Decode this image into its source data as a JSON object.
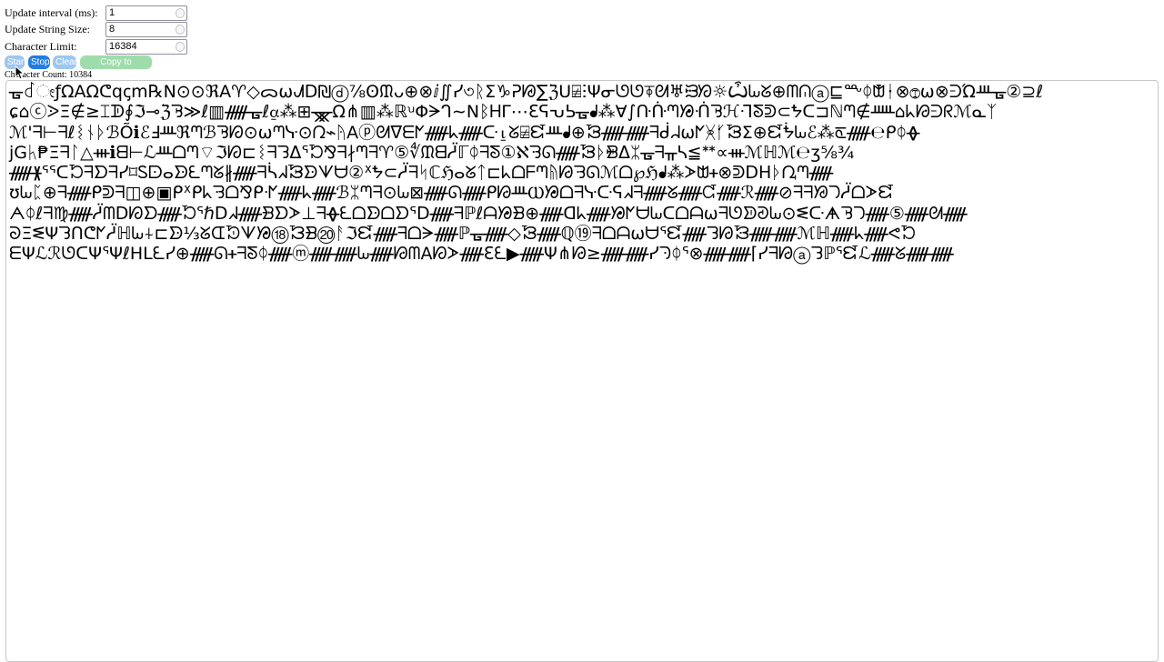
{
  "controls": {
    "interval_label": "Update interval (ms):",
    "interval_value": "1",
    "size_label": "Update String Size:",
    "size_value": "8",
    "limit_label": "Character Limit:",
    "limit_value": "16384"
  },
  "buttons": {
    "start": "Start",
    "stop": "Stop",
    "clear": "Clear",
    "copy": "Copy to clipboard"
  },
  "status": {
    "count_text": "Character Count: 10384"
  },
  "output_lines": [
    "ᚗ꒬ೕƒΩAΩᕦqꞔm℞N⊙⊙ℜA♈◇ᯅ⍵ᗂᗞ₪ⓓ⅞ʘᙢᴗ⊕⊗ⅈ∬ᓯ৩ᚱΣ♑ᕈᘘ∑ℨU⍯ⵗΨᓂᘎᘎ⍕ᘛ♅ᙥᘞ☼Ѽᘈᘜ⊕ᗰᕬⓐ⊑ᖖᛰᙧᚽ⊗Ⓣ⍵⊗ᕭΏᚈᚗ②⊇ℓ",
    "ɕ⌂ⓒᐷΞ∉≥⌶ᗫ∮ℑ⊸ℨᘋ≫ℓ▥ᚏᚗℓ⍶⁂⊞ᚘΩ⋔▥⁂ℝꭟΦᗒᒉ∼ΝᛒᎻΓ⋯ℇᕋᕃᕊᚗᖱ⁂Ɐ∫ᑚᑜᘉᘠᑛᘋℋᒬᘕᕲ⊂ᖬᑕ⊐ℕᘉ∉ᚊ⌂ᖾᘙᕭᖇℳᓇᛉ",
    "ℳ'ᖷ⊢ᖷℓᛵᚾᚦℬÕℹℰℲᚈℜᘉℬᘋᘗ⊙⍵ᘉᓷ⊙ᘣ⌁ᚤΑⓟᘛᐁᗴᖼᚏᖾᚏᑢ⍸ᘜ⍯ᘿᚈᖱ⊕ᘽᚏᚏᖷᑰᖹ⍵ᖼᚸᚶᘽΣ⊕ᘿᖭᘈℰ⁂ᖞᚏ℮ᑭᛰᚖ",
    "jGᛱ₱Ξᖷᛚ△ᚒℹᗺ⊢ℒᚈᗝᘉ⌔ℑᘗ⊏ᛵᖷᘊᐃᕐᘶ⅋ᖷ∤ᘉᖷ♈⑤∜ᙢᗺᓳℾᛰᖷᘕ①ℵᘌᘏᚏᘽᚦᙪᐃᛯᚗᖷᚂᓴ≦ᕯ∝ᚒℳℍℳ℮ʒ⅝¾",
    "ᚏᚕᕐᕐᑕᘶᖷᗤᖷᓯ⌑Ꮪᗠⴰᗦᘍᘉᘜ∦ᚏᖷᓵᖽᘽᗦᗐᗨ②ᕽᖬ⊂ᓳᖷᛋℂℌⴰᘜᛏ⊏ᖾᗝᖴᘉᚥᘙᘌᘏℳᗝ℘ℌᖱ⁂ᗆᗻᚐ⊗ᕲᗞᕼᚦᘩᘉᚏ",
    "ʊᘈᛈ⊕ᖷᚏᑭᕲᖷ◫⊕▣ᑭᕁᑭᖾᘌᗝ⅋ᑭᐧᖼᚏᖾᚏℬᛯᘉᖷ⊙ᘈ⊠ᚏᘏᚏᑭᘙᚈⲰᘠᗝᖷᓷᑢᕋᖽᖷᚏᘜᚏᘹᚏℛᚏ⊘ᖷᖷᘟᘄᓳᗝᗆᘿ",
    "ᗅᛰℓᖷ♍ᚏᓳᗰᗞᘗᗤᚏᘶᕐℏᗞᖽᚏᗿᗤᗆ⊥ᖷᚖᘍᗝᗦᗝᗤᕐᗞᚏᖷℙℓᗩᘠᗽ⊕ᚏᗡᖾᚏᘠᖼᗨᘈᑕᗝᗩ⍵ᖷᘎᗥᘑᘈ⊙ᓬᑢᗗᘋᘄᚏ⑤ᚏᘛᚏ",
    "ᘐΞᓬΨᘊᑎᕦᖼᓳℍᘈ⍭⊏ᗦ⅓ᘜᗭᘷᗐᘠ⑱ᘼᗽ⑳ᚨℑᘿᚏᖷᗝᗒᚏℙᚗᚏ◇ᘽᚏℚ⑲ᖷᗝᗩ⍵ᗨᕐᘿᚏᘊᘙᘾᚏᚏℳℍᚏᖾᚏᕙᘶ",
    "ᗴΨℒℛᘎᑕΨᕐΨℓΗLᘍᓯ⊕ᚏᘏᚐᖷᘕᛰᚏⓜᚏᚏᘈᚏᘙᗰΑᘗᗆᚏℇᘍ▶ᚏΨ⋔ᘙ≥ᚏᚏᓯᘆᛰᕐ⊗ᚏᚏ⌈ᓯᖷᘙⓐᘊℙᕐᘿℒᚏᘜᚏᚏ"
  ]
}
